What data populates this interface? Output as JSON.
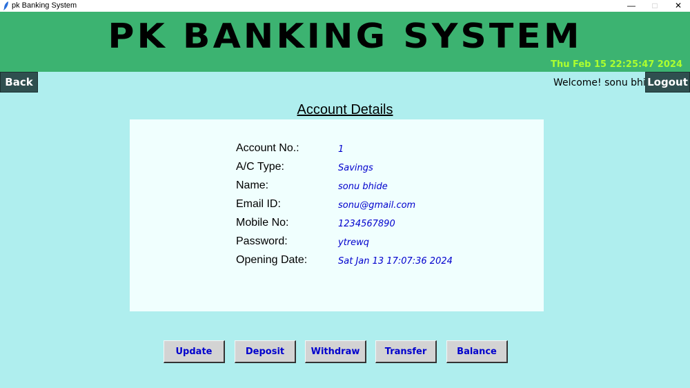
{
  "window": {
    "title": "pk Banking System",
    "minimize": "—",
    "maximize": "□",
    "close": "✕"
  },
  "header": {
    "banner": "PK BANKING SYSTEM",
    "datetime": "Thu Feb 15 22:25:47 2024"
  },
  "nav": {
    "back_label": "Back",
    "logout_label": "Logout",
    "welcome_text": "Welcome! sonu bhide"
  },
  "section": {
    "title": "Account Details"
  },
  "details": [
    {
      "label": "Account No.:",
      "value": "1"
    },
    {
      "label": "A/C Type:",
      "value": "Savings"
    },
    {
      "label": "Name:",
      "value": "sonu bhide"
    },
    {
      "label": "Email ID:",
      "value": "sonu@gmail.com"
    },
    {
      "label": "Mobile No:",
      "value": "1234567890"
    },
    {
      "label": "Password:",
      "value": "ytrewq"
    },
    {
      "label": "Opening Date:",
      "value": "Sat Jan 13 17:07:36 2024"
    }
  ],
  "actions": {
    "update": "Update",
    "deposit": "Deposit",
    "withdraw": "Withdraw",
    "transfer": "Transfer",
    "balance": "Balance"
  },
  "colors": {
    "background": "#afeeee",
    "header": "#3cb371",
    "datetime": "#adff2f",
    "nav_button": "#2f4f4f",
    "value_text": "#0000cd",
    "panel": "#f0fffe"
  }
}
